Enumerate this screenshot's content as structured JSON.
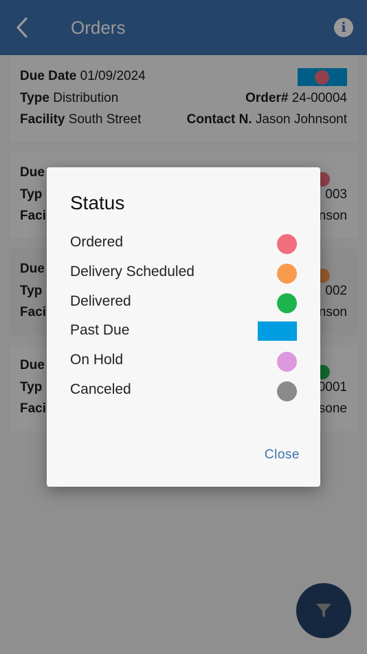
{
  "appbar": {
    "title": "Orders"
  },
  "orders": [
    {
      "due_label": "Due Date",
      "due_value": "01/09/2024",
      "type_label": "Type",
      "type_value": "Distribution",
      "order_label": "Order#",
      "order_value": "24-00004",
      "facility_label": "Facility",
      "facility_value": "South Street",
      "contact_label": "Contact N.",
      "contact_value": "Jason Johnsont",
      "status": "Past Due"
    },
    {
      "due_label": "Due",
      "type_label": "Typ",
      "order_value": "003",
      "facility_label": "Faci",
      "contact_value": "nson",
      "status": "Ordered"
    },
    {
      "due_label": "Due",
      "type_label": "Typ",
      "order_value": "002",
      "facility_label": "Faci",
      "contact_value": "nson",
      "status": "Delivery Scheduled"
    },
    {
      "due_label": "Due",
      "type_label": "Typ",
      "order_value": "0001",
      "facility_label": "Faci",
      "contact_value": "sone",
      "status": "Delivered"
    }
  ],
  "dialog": {
    "title": "Status",
    "items": [
      {
        "label": "Ordered",
        "color": "#f26d7d",
        "shape": "circle"
      },
      {
        "label": "Delivery Scheduled",
        "color": "#f99b4e",
        "shape": "circle"
      },
      {
        "label": "Delivered",
        "color": "#1db34d",
        "shape": "circle"
      },
      {
        "label": "Past Due",
        "color": "#009de0",
        "shape": "rect"
      },
      {
        "label": "On Hold",
        "color": "#dd99dd",
        "shape": "circle"
      },
      {
        "label": "Canceled",
        "color": "#8a8a8a",
        "shape": "circle"
      }
    ],
    "close_label": "Close"
  },
  "icons": {
    "back": "chevron-left-icon",
    "info": "info-icon",
    "filter": "filter-icon"
  },
  "colors": {
    "primary": "#3f72af",
    "dialog_bg": "#f7f7f7"
  }
}
